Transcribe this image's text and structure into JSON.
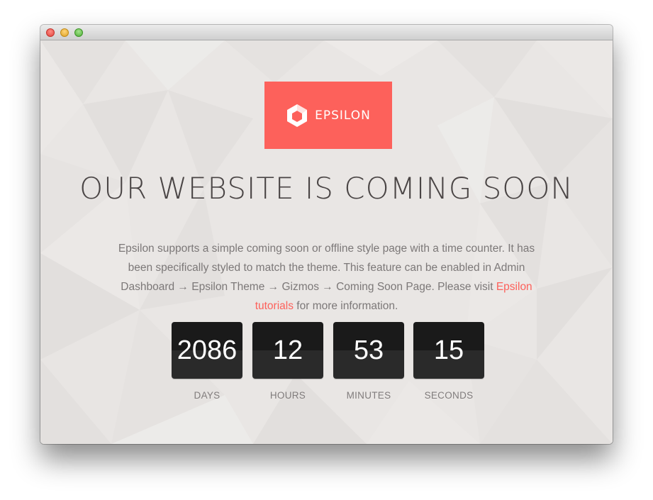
{
  "window": {
    "titlebar": {
      "buttons": [
        "close",
        "minimize",
        "maximize"
      ]
    }
  },
  "brand": {
    "name": "EPSILON",
    "icon": "hexagon-icon",
    "color": "#fd615b"
  },
  "headline": "OUR WEBSITE IS COMING SOON",
  "description": {
    "text_before_link": "Epsilon supports a simple coming soon or offline style page with a time counter. It has been specifically styled to match the theme. This feature can be enabled in Admin Dashboard → Epsilon Theme → Gizmos → Coming Soon Page. Please visit",
    "link_text": "Epsilon tutorials",
    "text_after_link": "for more information."
  },
  "countdown": [
    {
      "value": "2086",
      "label": "DAYS"
    },
    {
      "value": "12",
      "label": "HOURS"
    },
    {
      "value": "53",
      "label": "MINUTES"
    },
    {
      "value": "15",
      "label": "SECONDS"
    }
  ],
  "colors": {
    "accent": "#fd615b",
    "background": "#e9e6e4",
    "counter_box": "#1a1a1a",
    "headline": "#4a4545"
  }
}
